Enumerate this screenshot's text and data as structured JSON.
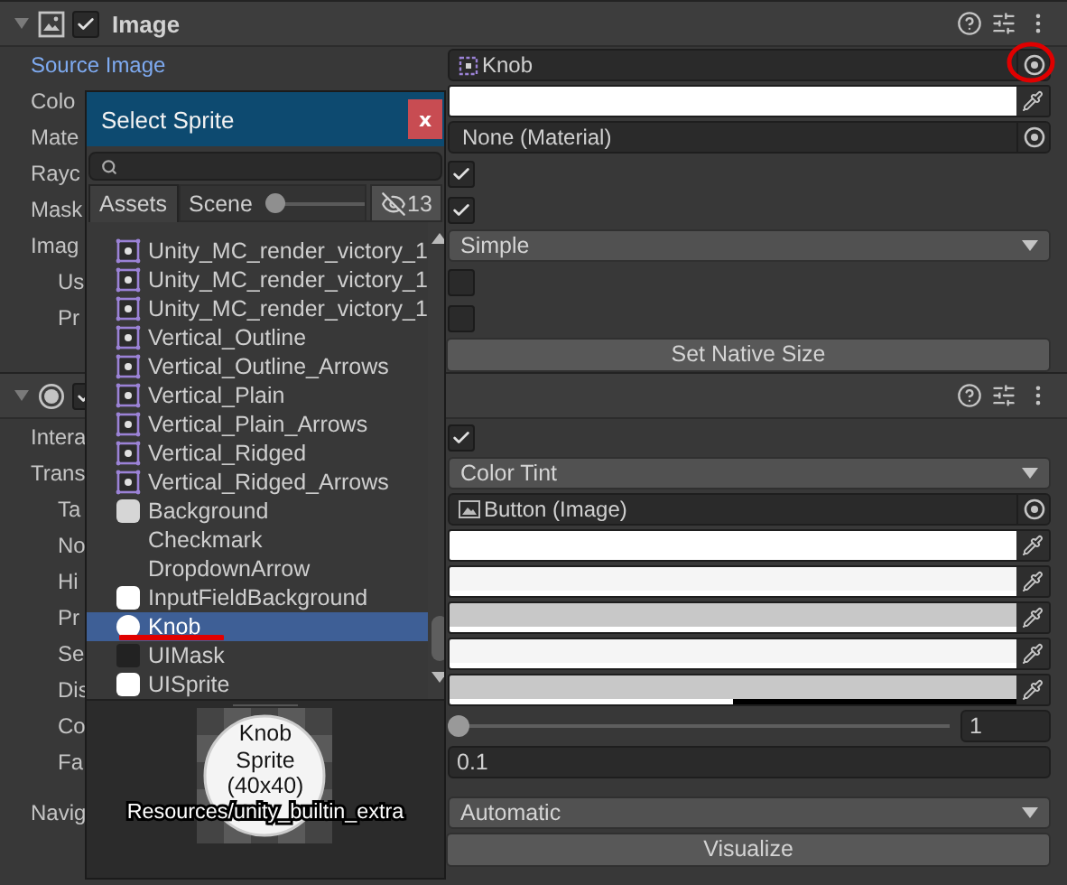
{
  "components": [
    {
      "title": "Image",
      "expanded": true,
      "enabled": true,
      "sections": [
        {
          "rows": [
            {
              "kind": "sprite_object",
              "label": "Source Image",
              "highlighted": true,
              "value": "Knob"
            },
            {
              "kind": "color",
              "label": "Colo",
              "color": "#ffffff",
              "level": 1
            },
            {
              "kind": "object",
              "label": "Mate",
              "value": "None (Material)"
            },
            {
              "kind": "checkbox",
              "label": "Rayc",
              "checked": true
            },
            {
              "kind": "checkbox",
              "label": "Mask",
              "checked": true
            },
            {
              "kind": "dropdown",
              "label": "Imag",
              "value": "Simple",
              "children": [
                {
                  "kind": "checkbox",
                  "label": "Us",
                  "checked": false
                },
                {
                  "kind": "checkbox",
                  "label": "Pr",
                  "checked": false
                }
              ]
            },
            {
              "kind": "button",
              "text": "Set Native Size"
            }
          ]
        }
      ]
    },
    {
      "expanded": true,
      "enabled": true,
      "sections": [
        {
          "rows": [
            {
              "kind": "checkbox",
              "label": "Intera",
              "checked": true
            },
            {
              "kind": "dropdown",
              "label": "Trans",
              "value": "Color Tint",
              "children": [
                {
                  "kind": "image_object",
                  "label": "Ta",
                  "value": "Button (Image)"
                },
                {
                  "kind": "color",
                  "label": "No",
                  "color": "#ffffff",
                  "level": 1
                },
                {
                  "kind": "color",
                  "label": "Hi",
                  "color": "#f5f5f5",
                  "level": 1
                },
                {
                  "kind": "color",
                  "label": "Pr",
                  "color": "#c8c8c8",
                  "level": 1
                },
                {
                  "kind": "color",
                  "label": "Se",
                  "color": "#f5f5f5",
                  "level": 1
                },
                {
                  "kind": "color",
                  "label": "Dis",
                  "color": "#c8c8c8",
                  "level": 0.5
                },
                {
                  "kind": "slider",
                  "label": "Co",
                  "level": 0,
                  "value": "1"
                },
                {
                  "kind": "number",
                  "label": "Fa",
                  "value": "0.1"
                }
              ]
            }
          ]
        },
        {
          "rows": [
            {
              "kind": "dropdown",
              "label": "Navig",
              "value": "Automatic"
            },
            {
              "kind": "button",
              "text": "Visualize"
            }
          ]
        }
      ]
    }
  ],
  "popup": {
    "title": "Select Sprite",
    "close": "x",
    "tabs": [
      {
        "label": "Assets",
        "selected": true
      },
      {
        "label": "Scene",
        "selected": false
      }
    ],
    "size_slider": {
      "level": 0
    },
    "hidden_count": "13",
    "items": [
      {
        "name": "Unity_MC_render_victory_1",
        "kind": "sprite",
        "selected": false
      },
      {
        "name": "Unity_MC_render_victory_1",
        "kind": "sprite",
        "selected": false
      },
      {
        "name": "Unity_MC_render_victory_1",
        "kind": "sprite",
        "selected": false
      },
      {
        "name": "Vertical_Outline",
        "kind": "sprite",
        "selected": false
      },
      {
        "name": "Vertical_Outline_Arrows",
        "kind": "sprite",
        "selected": false
      },
      {
        "name": "Vertical_Plain",
        "kind": "sprite",
        "selected": false
      },
      {
        "name": "Vertical_Plain_Arrows",
        "kind": "sprite",
        "selected": false
      },
      {
        "name": "Vertical_Ridged",
        "kind": "sprite",
        "selected": false
      },
      {
        "name": "Vertical_Ridged_Arrows",
        "kind": "sprite",
        "selected": false
      },
      {
        "name": "Background",
        "kind": "panel",
        "selected": false
      },
      {
        "name": "Checkmark",
        "kind": "none",
        "selected": false
      },
      {
        "name": "DropdownArrow",
        "kind": "none",
        "selected": false
      },
      {
        "name": "InputFieldBackground",
        "kind": "rounded",
        "selected": false
      },
      {
        "name": "Knob",
        "kind": "circle",
        "selected": true
      },
      {
        "name": "UIMask",
        "kind": "mask",
        "selected": false
      },
      {
        "name": "UISprite",
        "kind": "rounded",
        "selected": false
      }
    ],
    "preview": {
      "lines": [
        "Knob",
        "Sprite",
        "(40x40)"
      ],
      "path": "Resources/unity_builtin_extra"
    }
  }
}
